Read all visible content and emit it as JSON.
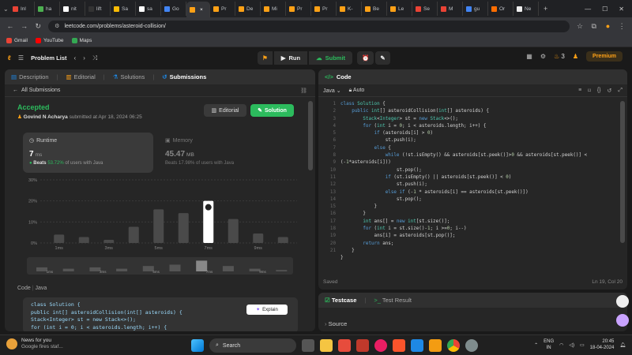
{
  "browser": {
    "tabs": [
      {
        "label": "Inl",
        "color": "#ea4335"
      },
      {
        "label": "ha",
        "color": "#4caf50"
      },
      {
        "label": "nit",
        "color": "#fff"
      },
      {
        "label": "lift",
        "color": "#333"
      },
      {
        "label": "Sa",
        "color": "#fbbc05"
      },
      {
        "label": "sa",
        "color": "#fff"
      },
      {
        "label": "Go",
        "color": "#4285f4"
      },
      {
        "label": "",
        "color": "#ffa116",
        "active": true
      },
      {
        "label": "Pr",
        "color": "#ffa116"
      },
      {
        "label": "De",
        "color": "#ffa116"
      },
      {
        "label": "Mi",
        "color": "#ffa116"
      },
      {
        "label": "Pr",
        "color": "#ffa116"
      },
      {
        "label": "Pr",
        "color": "#ffa116"
      },
      {
        "label": "K-",
        "color": "#ffa116"
      },
      {
        "label": "Be",
        "color": "#ffa116"
      },
      {
        "label": "Le",
        "color": "#ffa116"
      },
      {
        "label": "Se",
        "color": "#ea4335"
      },
      {
        "label": "M",
        "color": "#ea4335"
      },
      {
        "label": "gu",
        "color": "#4285f4"
      },
      {
        "label": "Or",
        "color": "#ff6d00"
      },
      {
        "label": "Ne",
        "color": "#eee"
      }
    ],
    "url": "leetcode.com/problems/asteroid-collision/",
    "bookmarks": [
      {
        "label": "Gmail",
        "color": "#ea4335"
      },
      {
        "label": "YouTube",
        "color": "#ff0000"
      },
      {
        "label": "Maps",
        "color": "#34a853"
      }
    ]
  },
  "nav": {
    "problem_list": "Problem List",
    "run": "Run",
    "submit": "Submit",
    "streak": "3",
    "premium": "Premium"
  },
  "left": {
    "tabs": [
      "Description",
      "Editorial",
      "Solutions",
      "Submissions"
    ],
    "all_submissions": "All Submissions",
    "status": "Accepted",
    "author": "Govind N Acharya",
    "submitted": "submitted at Apr 18, 2024 06:25",
    "editorial_btn": "Editorial",
    "solution_btn": "Solution",
    "runtime": {
      "title": "Runtime",
      "value": "7",
      "unit": "ms",
      "beats_prefix": "Beats",
      "beats": "53.72%",
      "beats_suffix": "of users with Java"
    },
    "memory": {
      "title": "Memory",
      "value": "45.47",
      "unit": "MB",
      "beats": "Beats 17.98% of users with Java"
    },
    "code_label": "Code",
    "code_lang": "Java",
    "explain": "Explain",
    "preview_lines": [
      "class Solution {",
      "    public int[] asteroidCollision(int[] asteroids) {",
      "        Stack<Integer> st = new Stack<>();",
      "        for (int i = 0; i < asteroids.length; i++) {"
    ]
  },
  "chart_data": {
    "type": "bar",
    "categories": [
      "1ms",
      "2ms",
      "3ms",
      "4ms",
      "5ms",
      "6ms",
      "7ms",
      "8ms",
      "9ms",
      "10ms"
    ],
    "values": [
      4.0,
      2.8,
      1.5,
      7.7,
      16.0,
      14.2,
      20.0,
      11.4,
      4.5,
      2.8
    ],
    "highlight_index": 6,
    "ylabel_ticks": [
      "0%",
      "10%",
      "20%",
      "30%"
    ],
    "xlabel_ticks": [
      "1ms",
      "3ms",
      "5ms",
      "7ms",
      "9ms"
    ],
    "ylim": [
      0,
      30
    ],
    "mini_values": [
      3,
      2,
      3,
      2,
      4,
      5,
      8,
      4,
      2,
      1
    ],
    "mini_labels": [
      "1ms",
      "3ms",
      "5ms",
      "7ms",
      "9ms"
    ]
  },
  "right": {
    "title": "Code",
    "lang": "Java",
    "mode": "Auto",
    "saved": "Saved",
    "cursor": "Ln 19, Col 20",
    "code": [
      "class Solution {",
      "    public int[] asteroidCollision(int[] asteroids) {",
      "        Stack<Integer> st = new Stack<>();",
      "        for (int i = 0; i < asteroids.length; i++) {",
      "            if (asteroids[i] > 0)",
      "                st.push(i);",
      "            else {",
      "                while (!st.isEmpty() && asteroids[st.peek()]>0 && asteroids[st.peek()] <",
      "(-1*asteroids[i]))",
      "                    st.pop();",
      "                if (st.isEmpty() || asteroids[st.peek()] < 0)",
      "                    st.push(i);",
      "                else if (-1 * asteroids[i] == asteroids[st.peek()])",
      "                    st.pop();",
      "            }",
      "        }",
      "        int ans[] = new int[st.size()];",
      "        for (int i = st.size()-1; i >=0; i--)",
      "            ans[i] = asteroids[st.pop()];",
      "        return ans;",
      "    }",
      "}"
    ],
    "line_numbers": [
      "1",
      "2",
      "3",
      "4",
      "5",
      "6",
      "7",
      "8",
      "",
      "9",
      "10",
      "11",
      "12",
      "13",
      "14",
      "15",
      "16",
      "17",
      "18",
      "19",
      "20",
      "21"
    ]
  },
  "testpanel": {
    "testcase": "Testcase",
    "result": "Test Result",
    "source": "Source"
  },
  "taskbar": {
    "news_title": "News for you",
    "news_sub": "Google fires staf...",
    "search": "Search",
    "lang": "ENG",
    "region": "IN",
    "time": "20:45",
    "date": "18-04-2024"
  }
}
